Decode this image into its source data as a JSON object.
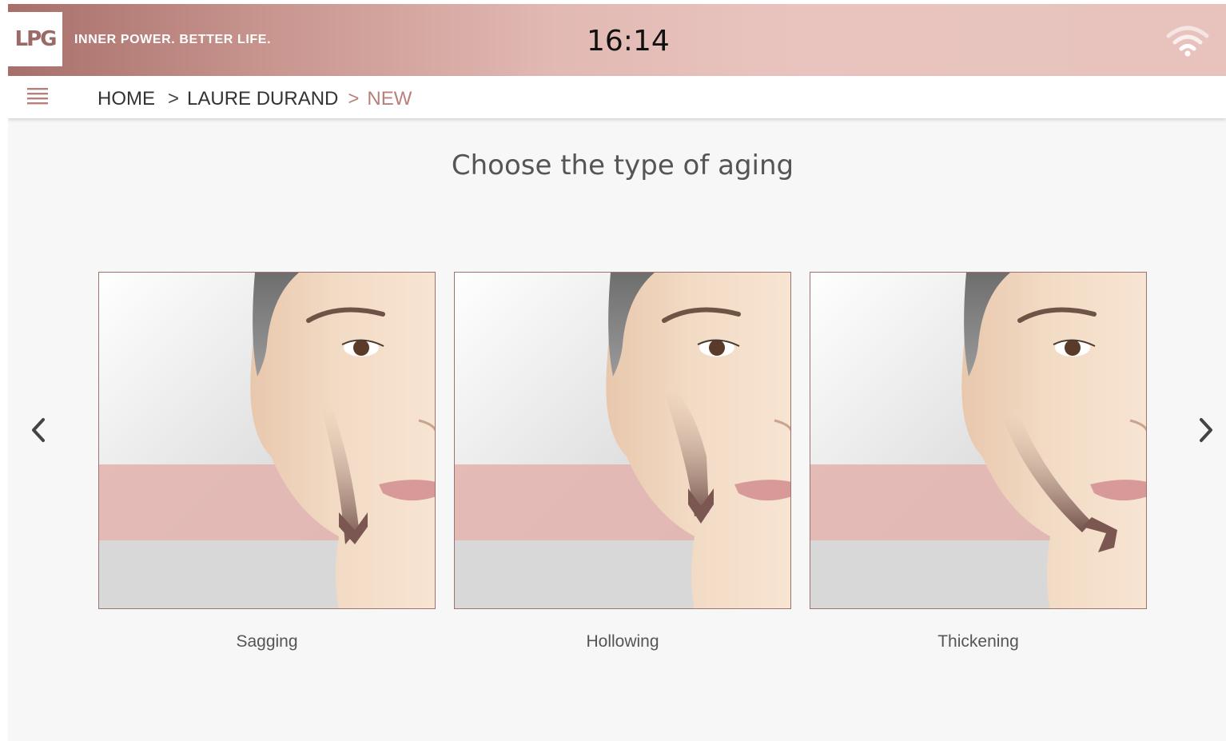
{
  "header": {
    "logo_text": "LPG",
    "tagline": "INNER POWER. BETTER LIFE.",
    "time": "16:14",
    "status_icon": "wifi-icon"
  },
  "navbar": {
    "menu_icon": "hamburger-menu-icon",
    "breadcrumb": {
      "home": "HOME",
      "separator": ">",
      "client": "LAURE DURAND",
      "current": "NEW"
    }
  },
  "main": {
    "title": "Choose the type of aging",
    "prev_icon": "chevron-left-icon",
    "next_icon": "chevron-right-icon",
    "options": [
      {
        "label": "Sagging",
        "image": "face-sagging-illustration"
      },
      {
        "label": "Hollowing",
        "image": "face-hollowing-illustration"
      },
      {
        "label": "Thickening",
        "image": "face-thickening-illustration"
      }
    ]
  },
  "colors": {
    "brand": "#b9807b",
    "brand_dark": "#9c6a66",
    "header_light": "#e9c4bf",
    "background": "#f7f7f7",
    "card_border": "#a0726d"
  }
}
